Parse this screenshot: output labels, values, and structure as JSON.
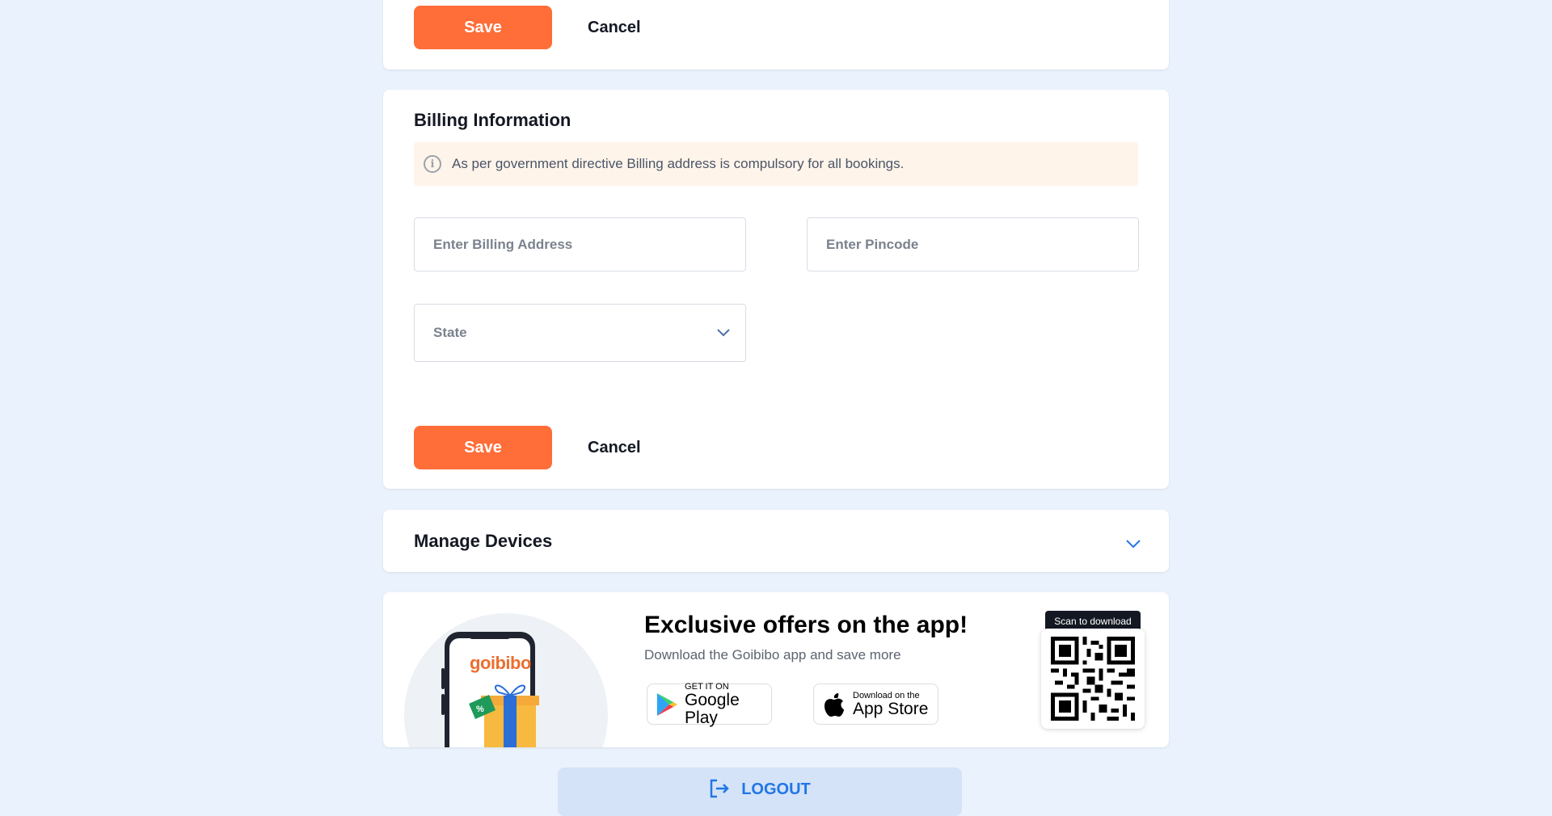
{
  "top_actions": {
    "save_label": "Save",
    "cancel_label": "Cancel"
  },
  "billing": {
    "title": "Billing Information",
    "notice": "As per government directive Billing address is compulsory for all bookings.",
    "address_placeholder": "Enter Billing Address",
    "pincode_placeholder": "Enter Pincode",
    "state_value": "State",
    "save_label": "Save",
    "cancel_label": "Cancel"
  },
  "devices": {
    "title": "Manage Devices"
  },
  "app_promo": {
    "brand": "goibibo",
    "title": "Exclusive offers on the app!",
    "subtitle": "Download the Goibibo app and save more",
    "google_small": "GET IT ON",
    "google_big": "Google Play",
    "apple_small": "Download on the",
    "apple_big": "App Store",
    "qr_label": "Scan to download"
  },
  "logout": {
    "label": "LOGOUT"
  },
  "colors": {
    "accent": "#ff6d38",
    "link_blue": "#2176e5",
    "page_bg": "#eaf2fd",
    "notice_bg": "#fff4ea"
  }
}
